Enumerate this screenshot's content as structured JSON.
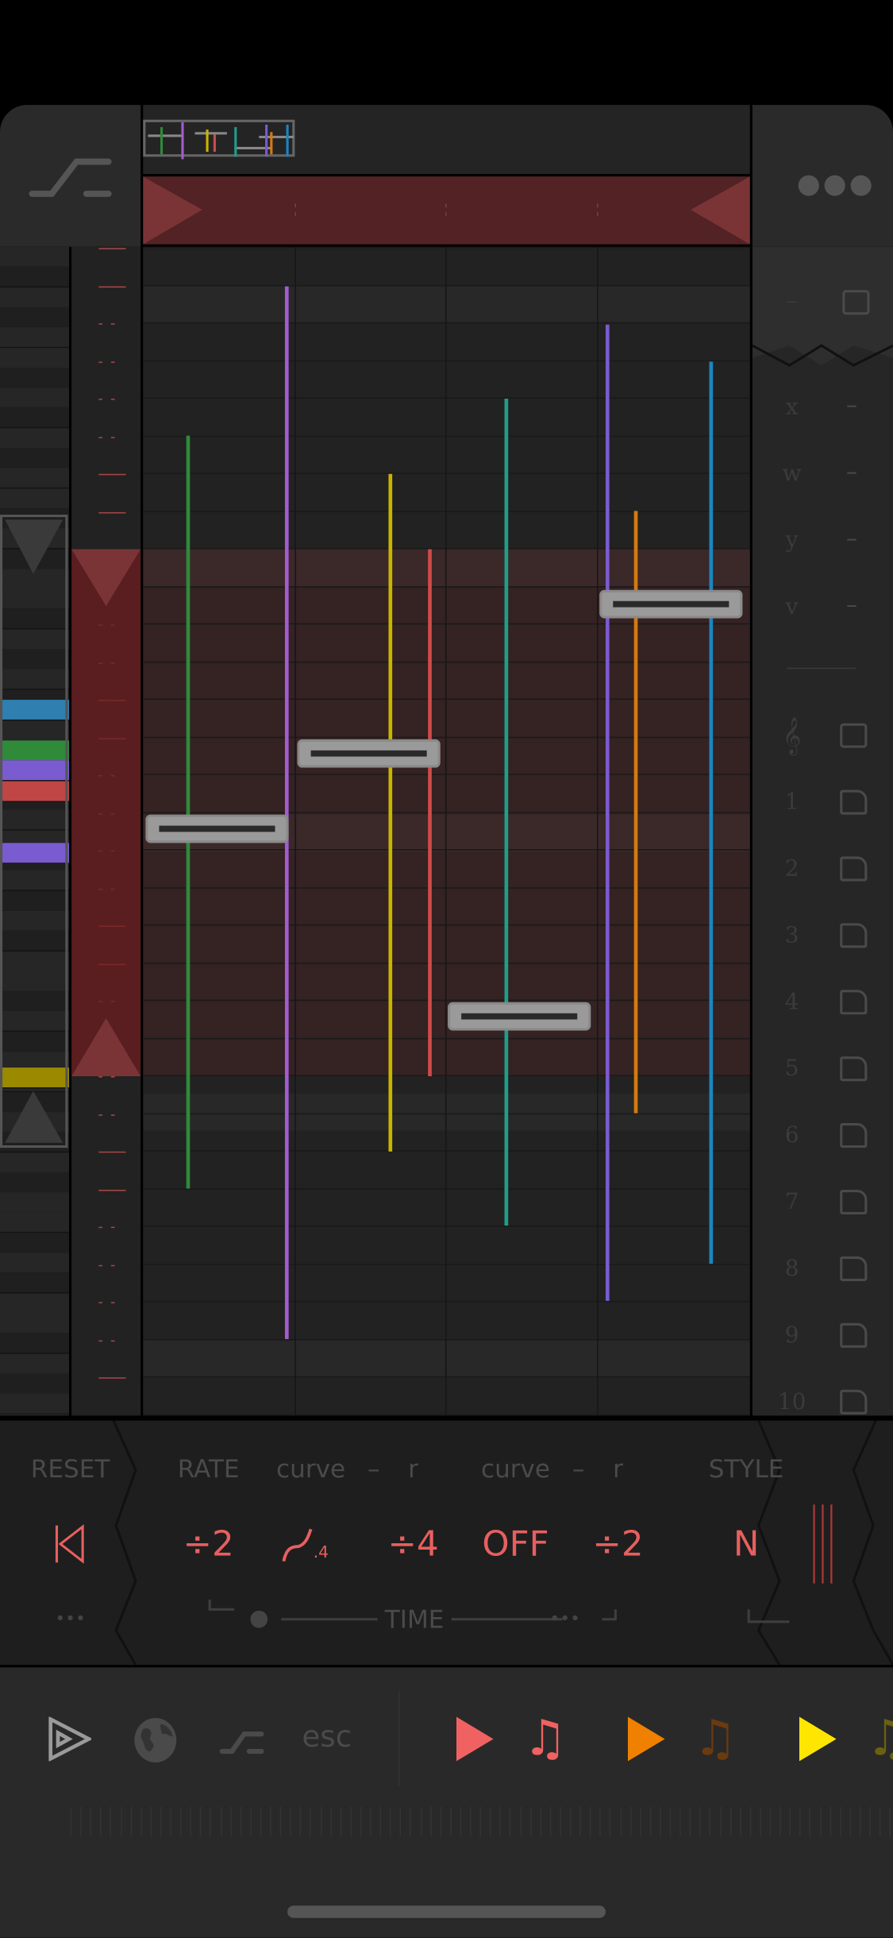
{
  "top_bar": {
    "left_icon": "curve-step-icon",
    "right_icon": "more-dots-icon"
  },
  "right_panel": {
    "header_dash": "–",
    "params": [
      {
        "label": "x",
        "value": "–"
      },
      {
        "label": "w",
        "value": "–"
      },
      {
        "label": "y",
        "value": "–"
      },
      {
        "label": "v",
        "value": "–"
      }
    ],
    "clef": "𝄞",
    "channels": [
      "1",
      "2",
      "3",
      "4",
      "5",
      "6",
      "7",
      "8",
      "9",
      "10"
    ]
  },
  "controls": {
    "labels": {
      "reset": "RESET",
      "rate": "RATE",
      "curve1": "curve",
      "dash1": "–",
      "r1": "r",
      "curve2": "curve",
      "dash2": "–",
      "r2": "r",
      "style": "STYLE"
    },
    "values": {
      "rate": "÷2",
      "curve1_suffix": ".4",
      "r1": "÷4",
      "curve2": "OFF",
      "r2": "÷2",
      "style": "N"
    },
    "more": "•••",
    "time_label": "TIME",
    "time_more": "•••"
  },
  "toolbar": {
    "esc": "esc"
  },
  "colors": {
    "accent": "#e85f5f",
    "tracks": [
      "#2f8a3a",
      "#a35bd0",
      "#c9b400",
      "#d14a4a",
      "#1f9e8a",
      "#7a5bd0",
      "#d47a10",
      "#1a86c0"
    ],
    "play_buttons": [
      "#f06262",
      "#f08000",
      "#ffe600"
    ],
    "note_icons": [
      "#f06262",
      "#6a3a10",
      "#6a6010"
    ]
  }
}
